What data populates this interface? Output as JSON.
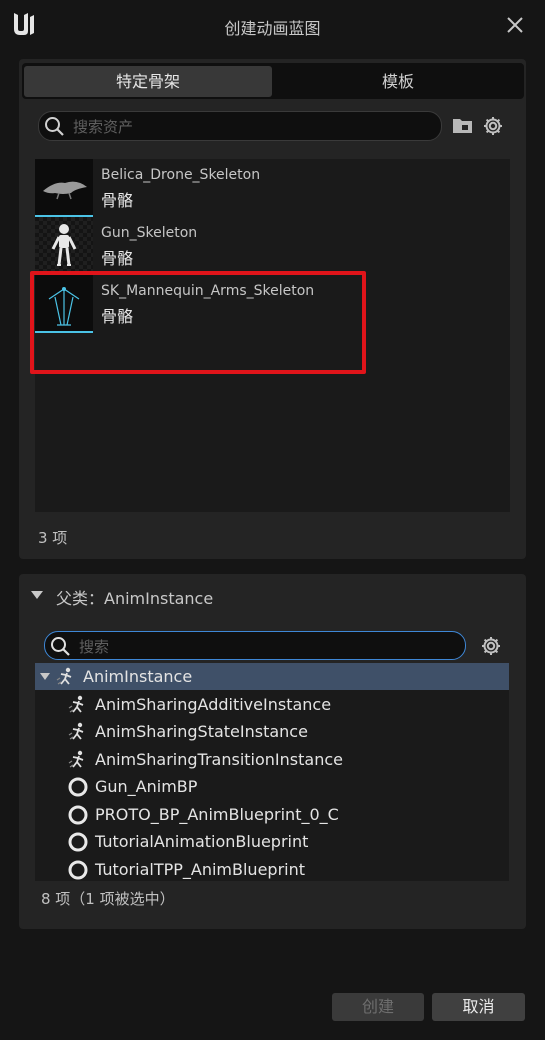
{
  "window": {
    "title": "创建动画蓝图"
  },
  "tabs": [
    {
      "label": "特定骨架",
      "active": true
    },
    {
      "label": "模板",
      "active": false
    }
  ],
  "asset_search": {
    "placeholder": "搜索资产"
  },
  "assets": [
    {
      "name": "Belica_Drone_Skeleton",
      "type": "骨骼"
    },
    {
      "name": "Gun_Skeleton",
      "type": "骨骼"
    },
    {
      "name": "SK_Mannequin_Arms_Skeleton",
      "type": "骨骼"
    }
  ],
  "asset_count": "3 项",
  "parent_section": {
    "title": "父类：AnimInstance"
  },
  "class_search": {
    "placeholder": "搜索"
  },
  "classes": [
    {
      "label": "AnimInstance",
      "icon": "anim-instance-icon",
      "selected": true
    },
    {
      "label": "AnimSharingAdditiveInstance",
      "icon": "anim-instance-icon"
    },
    {
      "label": "AnimSharingStateInstance",
      "icon": "anim-instance-icon"
    },
    {
      "label": "AnimSharingTransitionInstance",
      "icon": "anim-instance-icon"
    },
    {
      "label": "Gun_AnimBP",
      "icon": "blueprint-circle-icon"
    },
    {
      "label": "PROTO_BP_AnimBlueprint_0_C",
      "icon": "blueprint-circle-icon"
    },
    {
      "label": "TutorialAnimationBlueprint",
      "icon": "blueprint-circle-icon"
    },
    {
      "label": "TutorialTPP_AnimBlueprint",
      "icon": "blueprint-circle-icon"
    }
  ],
  "class_count": "8 项（1 项被选中）",
  "buttons": {
    "create": "创建",
    "cancel": "取消"
  },
  "colors": {
    "selection": "#3f5068",
    "highlight_box": "#e0141a",
    "focus_border": "#3e87d6",
    "thumb_accent": "#4bc3e6"
  }
}
